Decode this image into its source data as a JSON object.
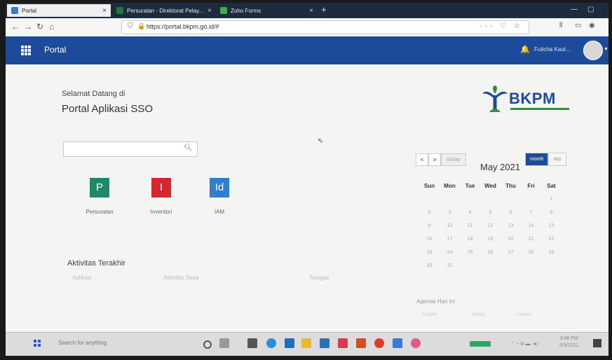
{
  "browser": {
    "tabs": [
      {
        "label": "Portal",
        "close": "×",
        "color": "#3c78d8"
      },
      {
        "label": "Persuratan - Direktorat Pelay...",
        "close": "×",
        "color": "#1e7a3a"
      },
      {
        "label": "Zoho Forms",
        "close": "×",
        "color": "#3cae4a"
      }
    ],
    "new_tab": "+",
    "url": "https://portal.bkpm.go.id/#",
    "url_actions": "··· ♡ ☆"
  },
  "header": {
    "title": "Portal",
    "user_name": "Futicha Kaut..."
  },
  "welcome": {
    "line1": "Selamat Datang di",
    "line2": "Portal Aplikasi SSO"
  },
  "logo": {
    "text": "BKPM"
  },
  "search": {
    "placeholder": ""
  },
  "apps": [
    {
      "letter": "P",
      "label": "Persuratan",
      "color": "#1f8a6a"
    },
    {
      "letter": "I",
      "label": "Inventori",
      "color": "#d6262e"
    },
    {
      "letter": "Id",
      "label": "IAM",
      "color": "#2f7fd0"
    }
  ],
  "activity": {
    "title": "Aktivitas Terakhir",
    "columns": [
      "Aplikasi",
      "Aktivitas Saya",
      "Tanggal"
    ]
  },
  "calendar": {
    "prev": "<",
    "next": ">",
    "today": "today",
    "title": "May 2021",
    "views": [
      "month",
      "day"
    ],
    "weekdays": [
      "Sun",
      "Mon",
      "Tue",
      "Wed",
      "Thu",
      "Fri",
      "Sat"
    ],
    "weeks": [
      [
        "",
        "",
        "",
        "",
        "",
        "",
        "1"
      ],
      [
        "2",
        "3",
        "4",
        "5",
        "6",
        "7",
        "8"
      ],
      [
        "9",
        "10",
        "11",
        "12",
        "13",
        "14",
        "15"
      ],
      [
        "16",
        "17",
        "18",
        "19",
        "20",
        "21",
        "22"
      ],
      [
        "23",
        "24",
        "25",
        "26",
        "27",
        "28",
        "29"
      ],
      [
        "30",
        "31",
        "",
        "",
        "",
        "",
        ""
      ]
    ]
  },
  "agenda": {
    "title": "Agenda Hari Ini",
    "columns": [
      "Subjek",
      "Waktu",
      "Lokasi"
    ]
  },
  "taskbar": {
    "search": "Search for anything",
    "time": "3:48 PM",
    "date": "5/3/2021"
  },
  "colors": {
    "brand": "#1e4a9a",
    "accent_green": "#2f8f3a"
  }
}
